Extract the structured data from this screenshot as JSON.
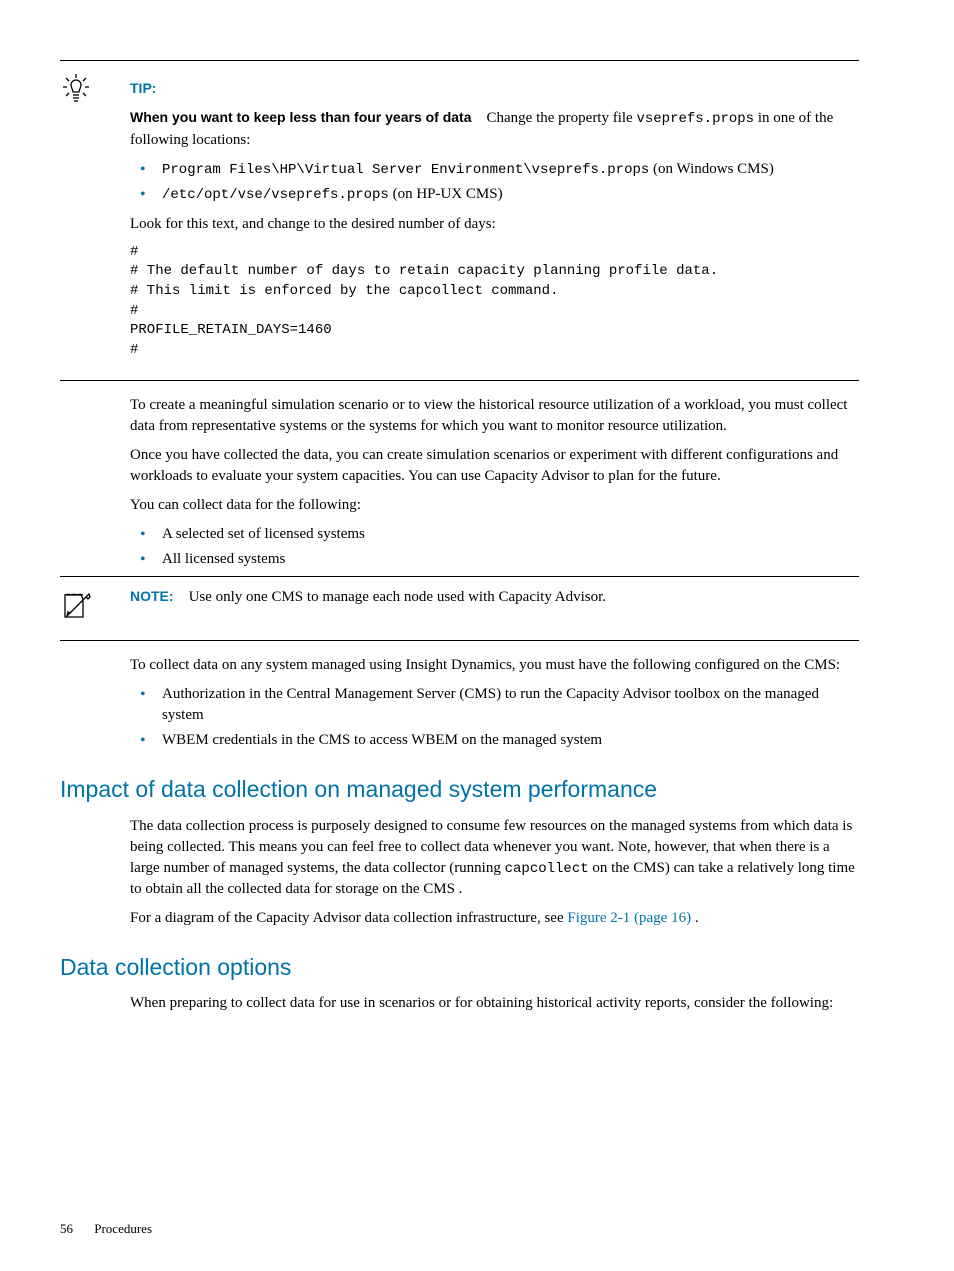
{
  "tip": {
    "label": "TIP:",
    "lead_bold": "When you want to keep less than four years of data",
    "lead_rest_1": "Change the property file ",
    "lead_code": "vseprefs.props",
    "lead_rest_2": " in one of the following locations:",
    "bullets": [
      {
        "code": "Program Files\\HP\\Virtual Server Environment\\vseprefs.props",
        "rest": " (on Windows CMS)"
      },
      {
        "code": "/etc/opt/vse/vseprefs.props",
        "rest": " (on HP-UX CMS)"
      }
    ],
    "after_bullets": "Look for this text, and change to the desired number of days:",
    "code_block": "#\n# The default number of days to retain capacity planning profile data.\n# This limit is enforced by the capcollect command.\n#\nPROFILE_RETAIN_DAYS=1460\n#"
  },
  "body": {
    "p1": "To create a meaningful simulation scenario or to view the historical resource utilization of a workload, you must collect data from representative systems or the systems for which you want to monitor resource utilization.",
    "p2": "Once you have collected the data, you can create simulation scenarios or experiment with different configurations and workloads to evaluate your system capacities. You can use Capacity Advisor to plan for the future.",
    "p3": "You can collect data for the following:",
    "bullets1": [
      "A selected set of licensed systems",
      "All licensed systems"
    ]
  },
  "note": {
    "label": "NOTE:",
    "text": "Use only one CMS to manage each node used with Capacity Advisor."
  },
  "after_note": {
    "p1": "To collect data on any system managed using Insight Dynamics, you must have the following configured on the CMS:",
    "bullets": [
      "Authorization in the Central Management Server (CMS) to run the Capacity Advisor toolbox on the managed system",
      "WBEM credentials in the CMS to access WBEM on the managed system"
    ]
  },
  "section1": {
    "heading": "Impact of data collection on managed system performance",
    "p1_a": "The data collection process is purposely designed to consume few resources on the managed systems from which data is being collected. This means you can feel free to collect data whenever you want. Note, however, that when there is a large number of managed systems, the data collector (running ",
    "p1_code": "capcollect",
    "p1_b": " on the CMS) can take a relatively long time to obtain all the collected data for storage on the CMS .",
    "p2_a": "For a diagram of the Capacity Advisor data collection infrastructure, see ",
    "p2_link": "Figure 2-1 (page 16)",
    "p2_b": " ."
  },
  "section2": {
    "heading": "Data collection options",
    "p1": "When preparing to collect data for use in scenarios or for obtaining historical activity reports, consider the following:"
  },
  "footer": {
    "page": "56",
    "title": "Procedures"
  }
}
